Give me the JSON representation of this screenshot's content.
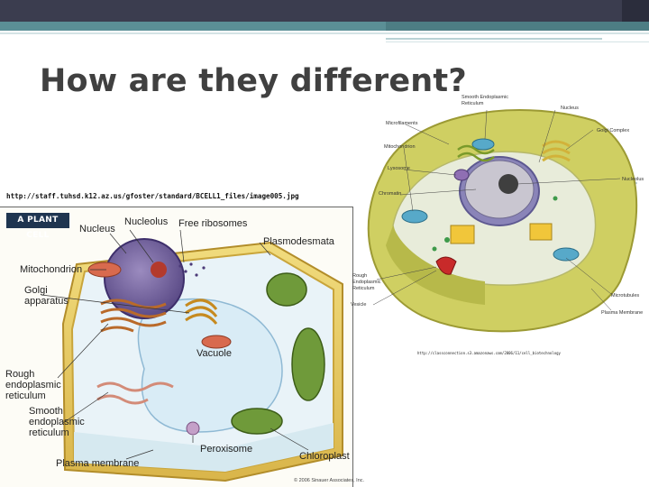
{
  "slide": {
    "title": "How are they different?"
  },
  "plant_cell": {
    "source_url": "http://staff.tuhsd.k12.az.us/gfoster/standard/BCELL1_files/image005.jpg",
    "badge": "A PLANT CELL",
    "labels": {
      "nucleus": "Nucleus",
      "nucleolus": "Nucleolus",
      "free_ribosomes": "Free ribosomes",
      "plasmodesmata": "Plasmodesmata",
      "mitochondrion": "Mitochondrion",
      "golgi_line1": "Golgi",
      "golgi_line2": "apparatus",
      "vacuole": "Vacuole",
      "rough_er_line1": "Rough",
      "rough_er_line2": "endoplasmic",
      "rough_er_line3": "reticulum",
      "smooth_er_line1": "Smooth",
      "smooth_er_line2": "endoplasmic",
      "smooth_er_line3": "reticulum",
      "peroxisome": "Peroxisome",
      "chloroplast": "Chloroplast",
      "plasma_membrane": "Plasma membrane",
      "credit": "© 2006 Sinauer Associates, Inc."
    }
  },
  "animal_cell": {
    "source_url": "http://classconnection.s3.amazonaws.com/2006/11/cell_biotechnology",
    "labels": {
      "smooth_er_line1": "Smooth Endoplasmic",
      "smooth_er_line2": "Reticulum",
      "nucleus": "Nucleus",
      "microfilaments": "Microfilaments",
      "golgi_complex": "Golgi Complex",
      "mitochondrion": "Mitochondrion",
      "lysosome": "Lysosome",
      "nucleolus": "Nucleolus",
      "chromatin": "Chromatin",
      "rough_line1": "Rough",
      "rough_line2": "Endoplasmic",
      "rough_line3": "Reticulum",
      "vesicle": "Vesicle",
      "microtubules": "Microtubules",
      "plasma_membrane": "Plasma Membrane"
    }
  },
  "colors": {
    "topbar": "#3b3d4f",
    "accent": "#5b8f96",
    "title_text": "#404040"
  }
}
